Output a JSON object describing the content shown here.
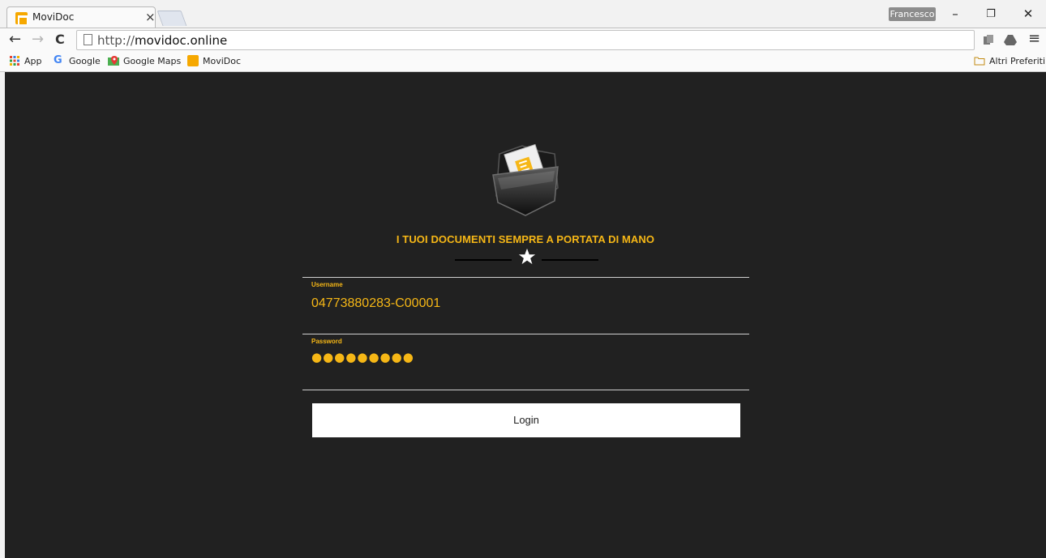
{
  "browser": {
    "tab_title": "MoviDoc",
    "tab_close": "×",
    "profile_name": "Francesco",
    "url_prefix": "http://",
    "url_host": "movidoc.online",
    "window_controls": {
      "minimize": "–",
      "restore": "❐",
      "close": "✕"
    },
    "nav": {
      "back": "←",
      "forward": "→",
      "reload": "C"
    },
    "menu_icon": "≡",
    "bookmarks": [
      {
        "label": "App",
        "icon": "apps-grid-icon"
      },
      {
        "label": "Google",
        "icon": "google-icon"
      },
      {
        "label": "Google Maps",
        "icon": "maps-pin-icon"
      },
      {
        "label": "MoviDoc",
        "icon": "movidoc-icon"
      }
    ],
    "other_bookmarks": "Altri Preferiti"
  },
  "page": {
    "tagline": "I TUOI DOCUMENTI SEMPRE A PORTATA DI MANO",
    "username": {
      "label": "Username",
      "value": "04773880283-C00001"
    },
    "password": {
      "label": "Password",
      "masked": "●●●●●●●●●"
    },
    "login_label": "Login"
  },
  "colors": {
    "accent": "#f6b716",
    "background": "#212121",
    "button": "#ffffff"
  }
}
